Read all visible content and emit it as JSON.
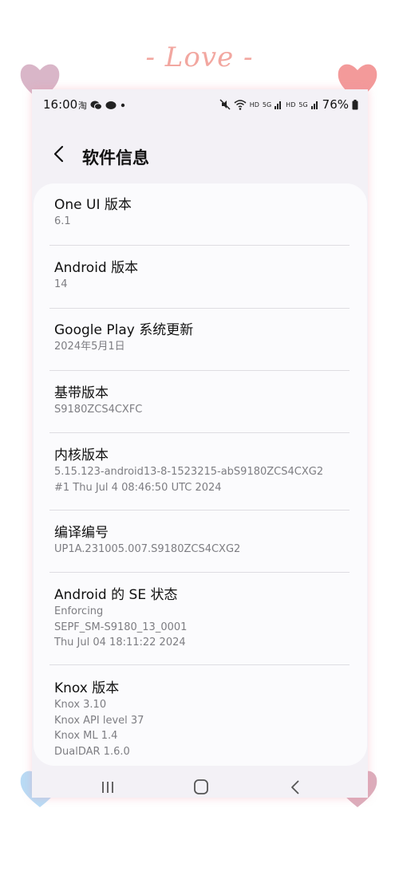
{
  "decoration": {
    "love_text": "- Love -",
    "accent_color": "#f2a7a0"
  },
  "status_bar": {
    "time": "16:00",
    "left_icons": [
      "taobao-icon",
      "wechat-icon",
      "chat-bubble-icon",
      "dot-icon"
    ],
    "hd1": "HD",
    "net1": "5G",
    "hd2": "HD",
    "net2": "5G",
    "battery": "76%"
  },
  "header": {
    "title": "软件信息"
  },
  "items": [
    {
      "title": "One UI 版本",
      "lines": [
        "6.1"
      ]
    },
    {
      "title": "Android 版本",
      "lines": [
        "14"
      ]
    },
    {
      "title": "Google Play 系统更新",
      "lines": [
        "2024年5月1日"
      ]
    },
    {
      "title": "基带版本",
      "lines": [
        "S9180ZCS4CXFC"
      ]
    },
    {
      "title": "内核版本",
      "lines": [
        "5.15.123-android13-8-1523215-abS9180ZCS4CXG2",
        "#1 Thu Jul 4 08:46:50 UTC 2024"
      ]
    },
    {
      "title": "编译编号",
      "lines": [
        "UP1A.231005.007.S9180ZCS4CXG2"
      ]
    },
    {
      "title": "Android 的 SE 状态",
      "lines": [
        "Enforcing",
        "SEPF_SM-S9180_13_0001",
        "Thu Jul 04 18:11:22 2024"
      ]
    },
    {
      "title": "Knox 版本",
      "lines": [
        "Knox 3.10",
        "Knox API level 37",
        "Knox ML 1.4",
        "DualDAR 1.6.0"
      ]
    }
  ],
  "nav": {
    "buttons": [
      "recents-icon",
      "home-icon",
      "back-icon"
    ]
  }
}
